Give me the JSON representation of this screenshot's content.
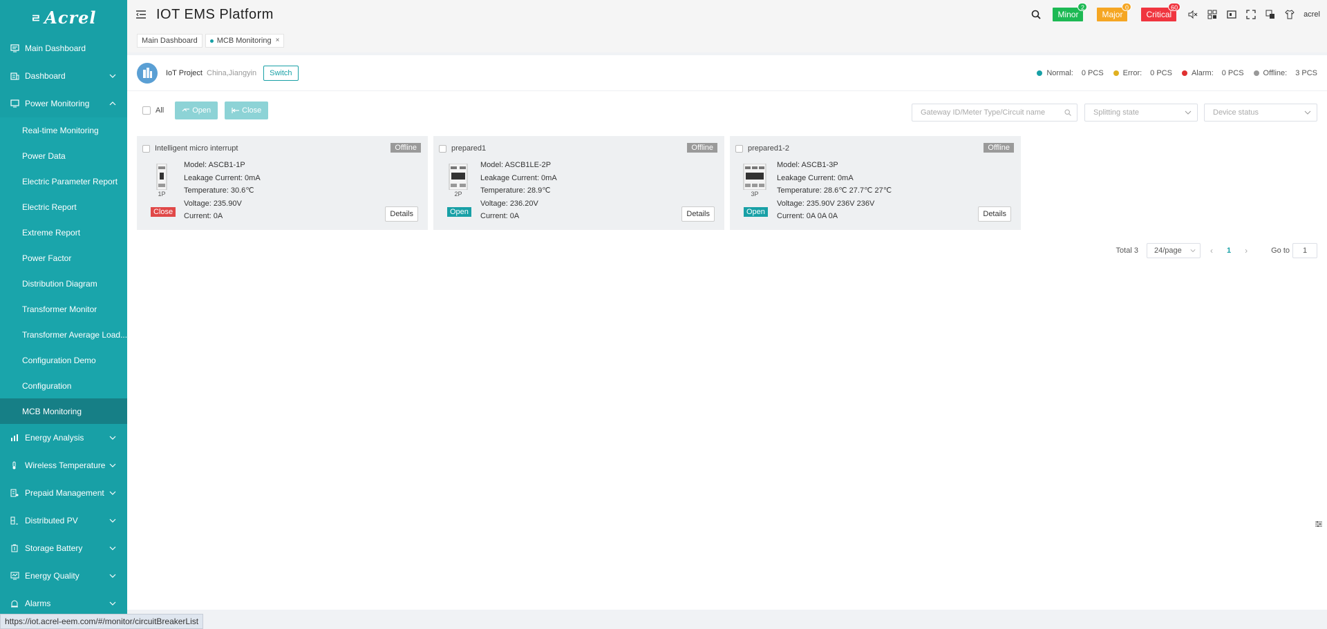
{
  "logo": {
    "text": "Acrel"
  },
  "sidebar": {
    "items": [
      {
        "label": "Main Dashboard",
        "icon": "monitor-icon"
      },
      {
        "label": "Dashboard",
        "icon": "building-icon"
      },
      {
        "label": "Power Monitoring",
        "icon": "monitor-icon"
      },
      {
        "label": "Energy Analysis",
        "icon": "bar-chart-icon"
      },
      {
        "label": "Wireless Temperature",
        "icon": "thermometer-icon"
      },
      {
        "label": "Prepaid Management",
        "icon": "prepaid-icon"
      },
      {
        "label": "Distributed PV",
        "icon": "solar-icon"
      },
      {
        "label": "Storage Battery",
        "icon": "battery-icon"
      },
      {
        "label": "Energy Quality",
        "icon": "quality-icon"
      },
      {
        "label": "Alarms",
        "icon": "alarm-icon"
      }
    ],
    "power_monitoring_sub": [
      "Real-time Monitoring",
      "Power Data",
      "Electric Parameter Report",
      "Electric Report",
      "Extreme Report",
      "Power Factor",
      "Distribution Diagram",
      "Transformer Monitor",
      "Transformer Average Load...",
      "Configuration Demo",
      "Configuration",
      "MCB Monitoring"
    ]
  },
  "header": {
    "title": "IOT EMS Platform",
    "alarms": {
      "minor": {
        "label": "Minor",
        "count": "2",
        "color": "#1db954"
      },
      "major": {
        "label": "Major",
        "count": "0",
        "color": "#f5a623"
      },
      "critical": {
        "label": "Critical",
        "count": "60",
        "color": "#f0353f"
      }
    },
    "user": "acrel"
  },
  "tabs": [
    {
      "label": "Main Dashboard"
    },
    {
      "label": "MCB Monitoring"
    }
  ],
  "project": {
    "name": "IoT Project",
    "location": "China,Jiangyin",
    "switch_label": "Switch"
  },
  "stats": [
    {
      "label": "Normal:",
      "value": "0 PCS",
      "color": "#18a0a6"
    },
    {
      "label": "Error:",
      "value": "0 PCS",
      "color": "#e0b020"
    },
    {
      "label": "Alarm:",
      "value": "0 PCS",
      "color": "#e03030"
    },
    {
      "label": "Offline:",
      "value": "3 PCS",
      "color": "#999999"
    }
  ],
  "toolbar": {
    "all_label": "All",
    "open_label": "Open",
    "close_label": "Close",
    "search_placeholder": "Gateway ID/Meter Type/Circuit name",
    "splitting_placeholder": "Splitting state",
    "status_placeholder": "Device status"
  },
  "cards": [
    {
      "name": "Intelligent micro interrupt",
      "status": "Offline",
      "pole": "1P",
      "state": "Close",
      "model": "Model:  ASCB1-1P",
      "leakage": "Leakage Current:  0mA",
      "temperature": "Temperature:  30.6℃",
      "voltage": "Voltage:  235.90V",
      "current": "Current:  0A",
      "details": "Details"
    },
    {
      "name": "prepared1",
      "status": "Offline",
      "pole": "2P",
      "state": "Open",
      "model": "Model:  ASCB1LE-2P",
      "leakage": "Leakage Current:  0mA",
      "temperature": "Temperature:  28.9℃",
      "voltage": "Voltage:  236.20V",
      "current": "Current:  0A",
      "details": "Details"
    },
    {
      "name": "prepared1-2",
      "status": "Offline",
      "pole": "3P",
      "state": "Open",
      "model": "Model:  ASCB1-3P",
      "leakage": "Leakage Current:  0mA",
      "temperature": "Temperature:  28.6℃ 27.7℃ 27℃",
      "voltage": "Voltage:  235.90V 236V 236V",
      "current": "Current:  0A 0A 0A",
      "details": "Details"
    }
  ],
  "pager": {
    "total": "Total 3",
    "page_size": "24/page",
    "current_page": "1",
    "goto_label": "Go to",
    "goto_value": "1"
  },
  "statusbar": {
    "url": "https://iot.acrel-eem.com/#/monitor/circuitBreakerList"
  }
}
